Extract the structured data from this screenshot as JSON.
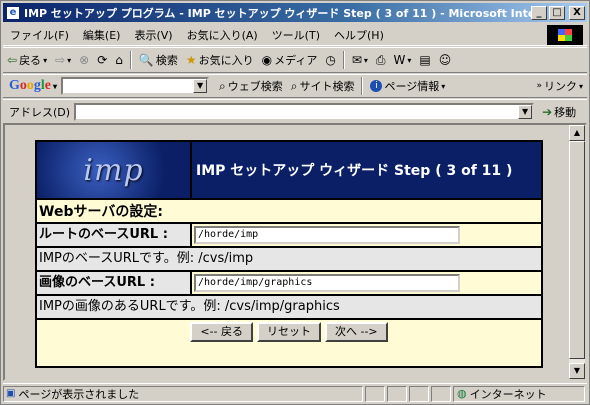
{
  "window": {
    "title": "IMP セットアップ プログラム - IMP セットアップ ウィザード Step ( 3 of 11 ) - Microsoft Internet Explorer",
    "minimize": "_",
    "maximize": "□",
    "close": "X"
  },
  "menu": [
    "ファイル(F)",
    "編集(E)",
    "表示(V)",
    "お気に入り(A)",
    "ツール(T)",
    "ヘルプ(H)"
  ],
  "toolbar": {
    "back": "戻る",
    "search": "検索",
    "favorites": "お気に入り",
    "media": "メディア"
  },
  "googlebar": {
    "logo": [
      "G",
      "o",
      "o",
      "g",
      "l",
      "e"
    ],
    "web_search": "ウェブ検索",
    "site_search": "サイト検索",
    "page_info": "ページ情報",
    "links": "リンク"
  },
  "address": {
    "label": "アドレス(D)",
    "value": "",
    "go": "移動"
  },
  "page": {
    "logo": "imp",
    "heading": "IMP セットアップ ウィザード  Step ( 3 of 11 )",
    "section": "Webサーバの設定:",
    "rows": [
      {
        "label": "ルートのベースURL :",
        "value": "/horde/imp",
        "desc": "IMPのベースURLです。例: /cvs/imp"
      },
      {
        "label": "画像のベースURL :",
        "value": "/horde/imp/graphics",
        "desc": "IMPの画像のあるURLです。例: /cvs/imp/graphics"
      }
    ],
    "buttons": {
      "back": "<-- 戻る",
      "reset": "リセット",
      "next": "次へ -->"
    }
  },
  "status": {
    "text": "ページが表示されました",
    "zone": "インターネット"
  }
}
